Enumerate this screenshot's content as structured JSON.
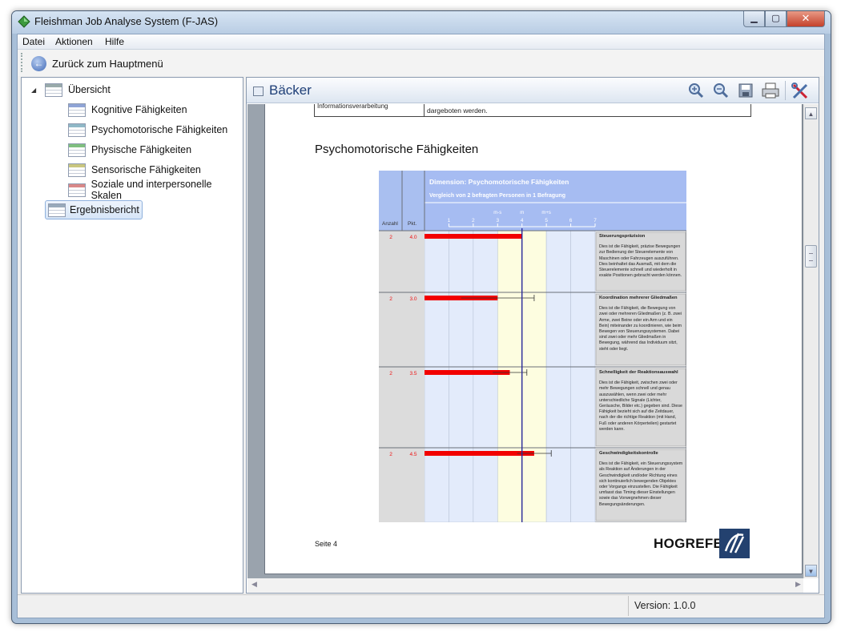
{
  "window": {
    "title": "Fleishman Job Analyse System (F-JAS)",
    "minimize": "▁",
    "maximize": "▢",
    "close": "✕"
  },
  "menubar": [
    "Datei",
    "Aktionen",
    "Hilfe"
  ],
  "toolbar": {
    "back_label": "Zurück zum Hauptmenü"
  },
  "tree": {
    "expander": "◢",
    "root": "Übersicht",
    "children": [
      {
        "label": "Kognitive Fähigkeiten",
        "color": "#8fa4d6"
      },
      {
        "label": "Psychomotorische Fähigkeiten",
        "color": "#8fb8c7"
      },
      {
        "label": "Physische Fähigkeiten",
        "color": "#7fbf7f"
      },
      {
        "label": "Sensorische Fähigkeiten",
        "color": "#c9c67f"
      },
      {
        "label": "Soziale und interpersonelle Skalen",
        "color": "#d98888"
      }
    ],
    "selected": "Ergebnisbericht"
  },
  "panel": {
    "title": "Bäcker"
  },
  "report": {
    "prev_left": "Informationsverarbeitung",
    "prev_right": "dargeboten werden.",
    "section_title": "Psychomotorische Fähigkeiten",
    "page_label": "Seite 4",
    "publisher": "HOGREFE"
  },
  "chart_data": {
    "type": "bar",
    "title": "Dimension: Psychomotorische Fähigkeiten",
    "subtitle": "Vergleich von 2 befragten Personen in 1 Befragung",
    "col_anzahl": "Anzahl",
    "col_pkt": "Pkt.",
    "scale_markers": [
      "m-s",
      "m",
      "m+s"
    ],
    "marker_positions": [
      3,
      4,
      5
    ],
    "xlim": [
      0,
      7
    ],
    "ticks": [
      1,
      2,
      3,
      4,
      5,
      6,
      7
    ],
    "mean": 4.0,
    "band": [
      3,
      5
    ],
    "rows": [
      {
        "count": "2",
        "points": "4.0",
        "value": 4.0,
        "err": 0.0,
        "name": "Steuerungspräzision",
        "desc": "Dies ist die Fähigkeit, präzise Bewegungen zur Bedienung der Steuerelemente von Maschinen oder Fahrzeugen auszuführen. Dies beinhaltet das Ausmaß, mit dem die Steuerelemente schnell und wiederholt in exakte Positionen gebracht werden können."
      },
      {
        "count": "2",
        "points": "3.0",
        "value": 3.0,
        "err": 1.5,
        "name": "Koordination mehrerer Gliedmaßen",
        "desc": "Dies ist die Fähigkeit, die Bewegung von zwei oder mehreren Gliedmaßen (z. B. zwei Arme, zwei Beine oder ein Arm und ein Bein) miteinander zu koordinieren, wie beim Bewegen von Steuerungssystemen. Dabei sind zwei oder mehr Gliedmaßen in Bewegung, während das Individuum sitzt, steht oder liegt."
      },
      {
        "count": "2",
        "points": "3.5",
        "value": 3.5,
        "err": 0.7,
        "name": "Schnelligkeit der Reaktionsauswahl",
        "desc": "Dies ist die Fähigkeit, zwischen zwei oder mehr Bewegungen schnell und genau auszuwählen, wenn zwei oder mehr unterschiedliche Signale (Lichter, Geräusche, Bilder etc.) gegeben sind. Diese Fähigkeit bezieht sich auf die Zeitdauer, nach der die richtige Reaktion (mit Hand, Fuß oder anderen Körperteilen) gestartet werden kann."
      },
      {
        "count": "2",
        "points": "4.5",
        "value": 4.5,
        "err": 0.7,
        "name": "Geschwindigkeitskontrolle",
        "desc": "Dies ist die Fähigkeit, ein Steuerungssystem als Reaktion auf Änderungen in der Geschwindigkeit und/oder Richtung eines sich kontinuierlich bewegenden Objektes oder Vorgangs einzustellen. Die Fähigkeit umfasst das Timing dieser Einstellungen sowie das Vorwegnehmen dieser Bewegungsänderungen."
      }
    ]
  },
  "status": {
    "version": "Version: 1.0.0"
  },
  "icons": {
    "back": "←",
    "zoom_in": "🔍+",
    "zoom_out": "🔍-",
    "save": "save-icon",
    "print": "print-icon",
    "tools": "tools-icon"
  }
}
